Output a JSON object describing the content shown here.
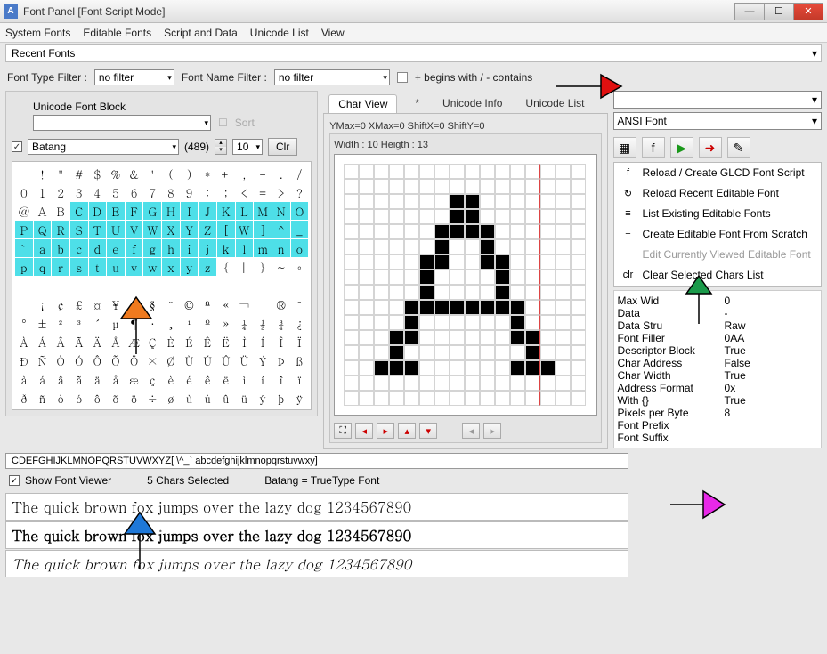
{
  "window": {
    "title": "Font Panel [Font Script Mode]",
    "min": "—",
    "max": "☐",
    "close": "✕"
  },
  "menu": [
    "System Fonts",
    "Editable Fonts",
    "Script and Data",
    "Unicode List",
    "View"
  ],
  "recent_label": "Recent Fonts",
  "filter": {
    "type_label": "Font Type Filter :",
    "type_value": "no filter",
    "name_label": "Font Name Filter :",
    "name_value": "no filter",
    "begins_label": "+ begins with / - contains"
  },
  "ublock_label": "Unicode Font Block",
  "sort_label": "Sort",
  "font_name": "Batang",
  "font_count": "(489)",
  "font_size": "10",
  "clr_label": "Clr",
  "grid_rows": [
    [
      " ",
      "!",
      "\"",
      "#",
      "$",
      "%",
      "&",
      "'",
      "(",
      ")",
      "*",
      "+",
      ",",
      "-",
      ".",
      "/"
    ],
    [
      "0",
      "1",
      "2",
      "3",
      "4",
      "5",
      "6",
      "7",
      "8",
      "9",
      ":",
      ";",
      "<",
      "=",
      ">",
      "?"
    ],
    [
      "@",
      "A",
      "B",
      "C",
      "D",
      "E",
      "F",
      "G",
      "H",
      "I",
      "J",
      "K",
      "L",
      "M",
      "N",
      "O"
    ],
    [
      "P",
      "Q",
      "R",
      "S",
      "T",
      "U",
      "V",
      "W",
      "X",
      "Y",
      "Z",
      "[",
      "₩",
      "]",
      "^",
      "_"
    ],
    [
      "`",
      "a",
      "b",
      "c",
      "d",
      "e",
      "f",
      "g",
      "h",
      "i",
      "j",
      "k",
      "l",
      "m",
      "n",
      "o"
    ],
    [
      "p",
      "q",
      "r",
      "s",
      "t",
      "u",
      "v",
      "w",
      "x",
      "y",
      "z",
      "{",
      "|",
      "}",
      "~",
      "◦"
    ],
    [
      " ",
      " ",
      " ",
      " ",
      " ",
      " ",
      " ",
      " ",
      " ",
      " ",
      " ",
      " ",
      " ",
      " ",
      " ",
      " "
    ],
    [
      " ",
      "¡",
      "¢",
      "£",
      "¤",
      "¥",
      "¦",
      "§",
      "¨",
      "©",
      "ª",
      "«",
      "¬",
      " ",
      "®",
      "¯"
    ],
    [
      "°",
      "±",
      "²",
      "³",
      "´",
      "µ",
      "¶",
      "·",
      "¸",
      "¹",
      "º",
      "»",
      "¼",
      "½",
      "¾",
      "¿"
    ],
    [
      "À",
      "Á",
      "Â",
      "Ã",
      "Ä",
      "Å",
      "Æ",
      "Ç",
      "È",
      "É",
      "Ê",
      "Ë",
      "Ì",
      "Í",
      "Î",
      "Ï"
    ],
    [
      "Ð",
      "Ñ",
      "Ò",
      "Ó",
      "Ô",
      "Õ",
      "Ö",
      "×",
      "Ø",
      "Ù",
      "Ú",
      "Û",
      "Ü",
      "Ý",
      "Þ",
      "ß"
    ],
    [
      "à",
      "á",
      "â",
      "ã",
      "ä",
      "å",
      "æ",
      "ç",
      "è",
      "é",
      "ê",
      "ë",
      "ì",
      "í",
      "î",
      "ï"
    ],
    [
      "ð",
      "ñ",
      "ò",
      "ó",
      "ô",
      "õ",
      "ö",
      "÷",
      "ø",
      "ù",
      "ú",
      "û",
      "ü",
      "ý",
      "þ",
      "ÿ"
    ]
  ],
  "sel_ranges": [
    [
      2,
      3,
      15
    ],
    [
      3,
      0,
      15
    ],
    [
      4,
      0,
      15
    ],
    [
      5,
      0,
      10
    ]
  ],
  "midtabs": {
    "charview": "Char View",
    "star": "*",
    "uinfo": "Unicode Info",
    "ulist": "Unicode List"
  },
  "cv": {
    "ymax": "YMax=0  XMax=0  ShiftX=0  ShiftY=0",
    "wh": "Width : 10  Heigth : 13"
  },
  "right": {
    "ansi": "ANSI Font",
    "menu": [
      {
        "icon": "f",
        "label": "Reload / Create GLCD Font Script",
        "kind": "n"
      },
      {
        "icon": "↻",
        "label": "Reload Recent Editable Font",
        "kind": "n"
      },
      {
        "icon": "≡",
        "label": "List Existing Editable Fonts",
        "kind": "n"
      },
      {
        "icon": "+",
        "label": "Create Editable Font From Scratch",
        "kind": "n"
      },
      {
        "icon": " ",
        "label": "Edit Currently Viewed Editable Font",
        "kind": "d"
      },
      {
        "icon": "clr",
        "label": "Clear Selected Chars List",
        "kind": "n"
      }
    ],
    "props": [
      [
        "Max Wid",
        "0"
      ],
      [
        "Data",
        "-"
      ],
      [
        "Data Stru",
        "Raw"
      ],
      [
        "Font Filler",
        "0AA"
      ],
      [
        "Descriptor Block",
        "True"
      ],
      [
        "Char Address",
        "False"
      ],
      [
        "Char Width",
        "True"
      ],
      [
        "Address Format",
        "0x"
      ],
      [
        "With {}",
        "True"
      ],
      [
        "Pixels per Byte",
        "8"
      ],
      [
        "Font Prefix",
        ""
      ],
      [
        "Font Suffix",
        ""
      ]
    ]
  },
  "selected_chars": "CDEFGHIJKLMNOPQRSTUVWXYZ[ \\^_` abcdefghijklmnopqrstuvwxy]",
  "show_viewer_label": "Show Font Viewer",
  "chars_selected": "5 Chars Selected",
  "font_status": "Batang = TrueType Font",
  "sample_text": "The quick brown fox jumps over the lazy dog 1234567890"
}
